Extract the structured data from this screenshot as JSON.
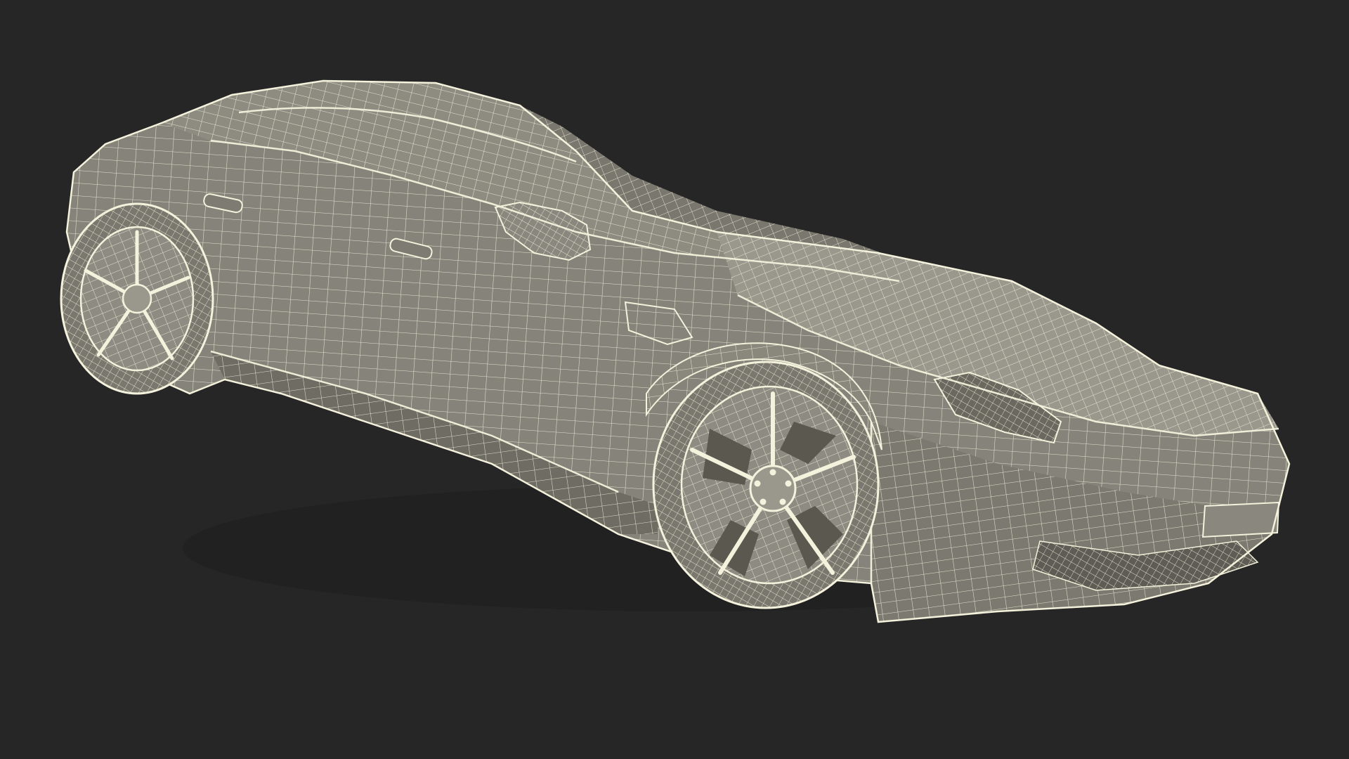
{
  "scene": {
    "subject": "sports-car-wireframe",
    "colors": {
      "background": "#262626",
      "body_fill": "#86847a",
      "body_fill_dark": "#6e6c63",
      "body_fill_light": "#9a988d",
      "wire": "#f4f1dc",
      "shadow": "#565549"
    }
  }
}
